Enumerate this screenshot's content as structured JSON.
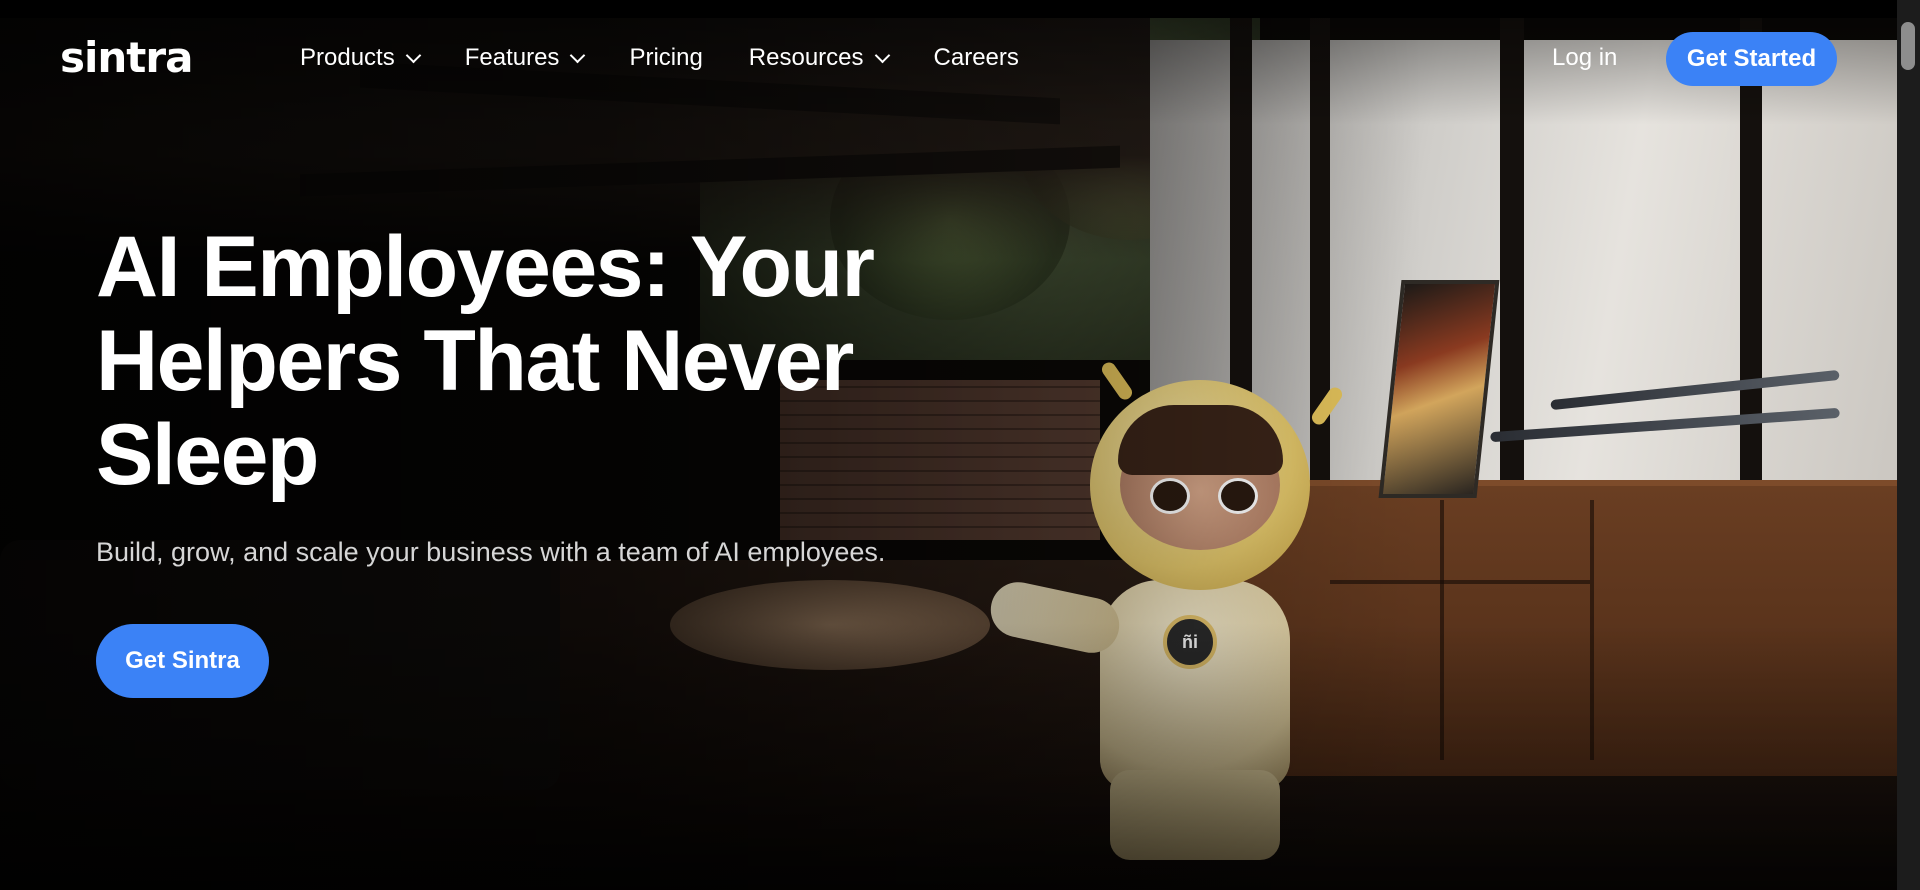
{
  "brand": {
    "logo_text": "sintra",
    "accent_color": "#3b82f6"
  },
  "nav": {
    "items": [
      {
        "label": "Products",
        "has_dropdown": true
      },
      {
        "label": "Features",
        "has_dropdown": true
      },
      {
        "label": "Pricing",
        "has_dropdown": false
      },
      {
        "label": "Resources",
        "has_dropdown": true
      },
      {
        "label": "Careers",
        "has_dropdown": false
      }
    ],
    "login_label": "Log in",
    "cta_label": "Get Started"
  },
  "hero": {
    "title": "AI Employees: Your Helpers That Never Sleep",
    "subtitle": "Build, grow, and scale your business with a team of AI employees.",
    "cta_label": "Get Sintra",
    "mascot_badge": "ñi"
  }
}
